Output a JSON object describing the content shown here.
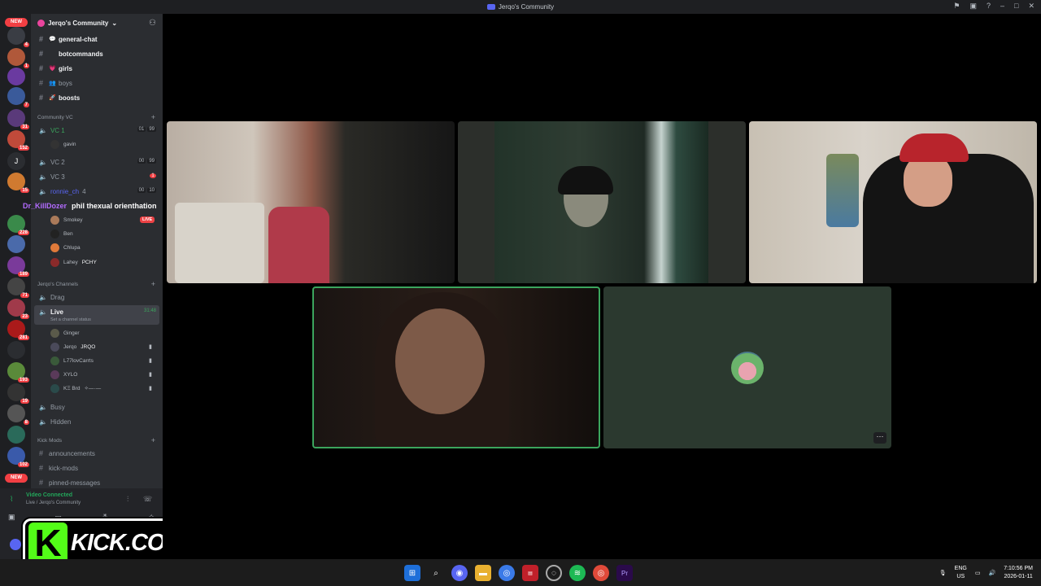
{
  "window": {
    "title": "Jerqo's Community"
  },
  "server": {
    "name": "Jerqo's Community"
  },
  "text_channels": [
    {
      "emoji": "💬",
      "name": "general-chat",
      "bold": true
    },
    {
      "emoji": "",
      "name": "botcommands",
      "bold": true
    },
    {
      "emoji": "💗",
      "name": "girls",
      "bold": true
    },
    {
      "emoji": "👥",
      "name": "boys",
      "bold": false
    },
    {
      "emoji": "🚀",
      "name": "boosts",
      "bold": true
    }
  ],
  "community_vc": {
    "category": "Community VC",
    "vc1": {
      "name": "VC 1",
      "count_a": "01",
      "count_b": "99",
      "user": "gavin"
    },
    "vc2": {
      "name": "VC 2",
      "count_a": "00",
      "count_b": "99"
    },
    "vc3": {
      "name": "VC 3",
      "badge": "1"
    },
    "vc4": {
      "name": "4",
      "count_a": "00",
      "count_b": "10",
      "overlay_name1": "ronnie_ch",
      "overlay_name2": "Dr_KillDozer",
      "overlay_text": "phil thexual orienthation"
    },
    "users": [
      {
        "name": "Smokey",
        "tag": "LIVE"
      },
      {
        "name": "Ben",
        "tag": ""
      },
      {
        "name": "Chlupa",
        "tag": ""
      },
      {
        "name": "Lahey",
        "tag": "PCHY"
      }
    ]
  },
  "jerqo_channels": {
    "category": "Jerqo's Channels",
    "drag": "Drag",
    "live": {
      "name": "Live",
      "timer": "31:48",
      "status": "Set a channel status"
    },
    "members": [
      {
        "name": "Ginger",
        "tag": ""
      },
      {
        "name": "Jerqo",
        "tag": "JRQO"
      },
      {
        "name": "L77lovCarrts",
        "tag": ""
      },
      {
        "name": "XYLO",
        "tag": ""
      },
      {
        "name": "KΞ Brd",
        "tag": "✧—·—"
      }
    ],
    "busy": "Busy",
    "hidden": "Hidden"
  },
  "kick_mods": {
    "category": "Kick Mods",
    "channels": [
      "announcements",
      "kick-mods",
      "pinned-messages"
    ]
  },
  "voice_panel": {
    "status": "Video Connected",
    "sub": "Live / Jerqo's Community"
  },
  "server_badges": [
    "4",
    "1",
    "7",
    "31",
    "152",
    "15",
    "228",
    "189",
    "71",
    "23",
    "281",
    "193",
    "19",
    "8",
    "102"
  ],
  "new_label": "NEW",
  "kick_banner": {
    "k": "K",
    "text": "KICK.COM/JERQO"
  },
  "taskbar": {
    "lang_top": "ENG",
    "lang_bottom": "US",
    "time": "7:10:56 PM",
    "date": "2026-01-11"
  }
}
